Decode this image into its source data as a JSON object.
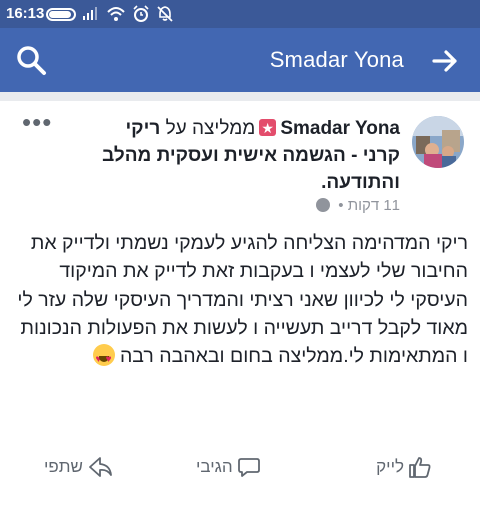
{
  "status_bar": {
    "time": "16:13",
    "icons": [
      "battery-icon",
      "signal-icon",
      "wifi-icon",
      "alarm-icon",
      "mute-icon"
    ]
  },
  "app_bar": {
    "title": "Smadar Yona",
    "search_icon": "search-icon",
    "back_icon": "arrow-right-icon",
    "color": "#4267b2"
  },
  "post": {
    "author": "Smadar Yona",
    "recommends_text": "ממליצה על",
    "page_name": "ריקי קרני - הגשמה אישית ועסקית מהלב והתודעה.",
    "time": "11 דקות",
    "body_text": "ריקי המדהימה הצליחה להגיע לעמקי נשמתי ולדייק את החיבור שלי לעצמי ו בעקבות זאת לדייק את המיקוד העיסקי לי לכיוון שאני רציתי והמדריך העיסקי שלה עזר לי מאוד לקבל דרייב תעשייה ו לעשות את הפעולות הנכונות ו המתאימות לי.ממליצה בחום ובאהבה רבה",
    "emoji": "heart-eyes-emoji"
  },
  "actions": {
    "like": "לייק",
    "comment": "הגיבי",
    "share": "שתפי"
  }
}
